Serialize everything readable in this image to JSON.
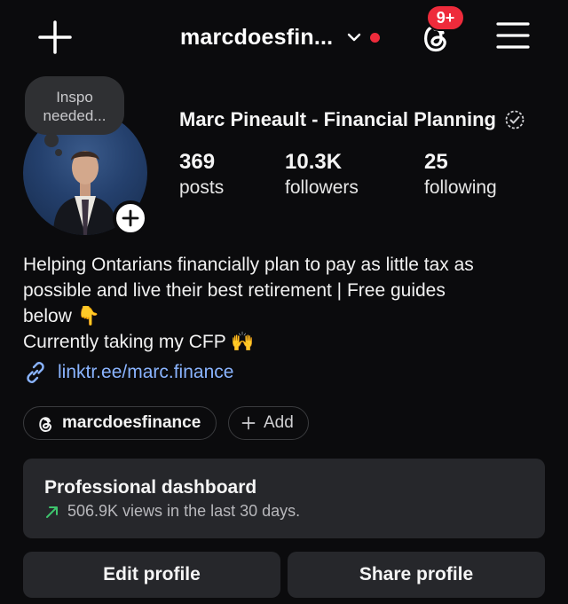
{
  "header": {
    "username": "marcdoesfin...",
    "notification_badge": "9+",
    "icons": {
      "create": "plus-icon",
      "switch_account": "chevron-down-icon",
      "threads": "threads-icon",
      "menu": "hamburger-menu-icon"
    },
    "accent_red": "#ee2b3b"
  },
  "profile": {
    "note": "Inspo needed...",
    "display_name": "Marc Pineault - Financial Planning",
    "stats": [
      {
        "value": "369",
        "label": "posts"
      },
      {
        "value": "10.3K",
        "label": "followers"
      },
      {
        "value": "25",
        "label": "following"
      }
    ],
    "bio_lines": [
      "Helping Ontarians financially plan to pay as little tax as",
      "possible and live their best retirement | Free guides",
      "below 👇",
      "Currently taking my CFP 🙌"
    ],
    "link": "linktr.ee/marc.finance",
    "link_color": "#8ab4ff"
  },
  "chips": {
    "threads_handle": "marcdoesfinance",
    "add_label": "Add"
  },
  "dashboard": {
    "title": "Professional dashboard",
    "subtitle": "506.9K views in the last 30 days.",
    "trend_color": "#3ec46d"
  },
  "actions": {
    "edit": "Edit profile",
    "share": "Share profile"
  }
}
